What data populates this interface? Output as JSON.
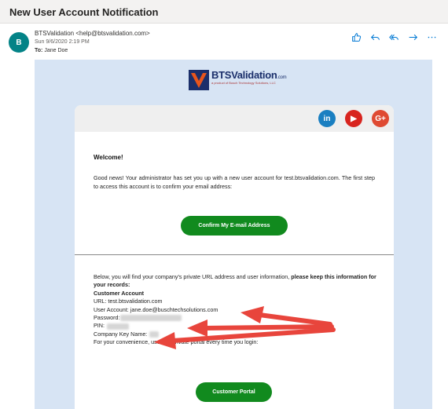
{
  "window": {
    "subject": "New User Account Notification"
  },
  "message": {
    "avatar_initial": "B",
    "sender": "BTSValidation <help@btsvalidation.com>",
    "date": "Sun 9/6/2020 2:19 PM",
    "to_label": "To:",
    "to_value": "Jane Doe"
  },
  "actions": [
    {
      "icon": "like-icon"
    },
    {
      "icon": "reply-icon"
    },
    {
      "icon": "reply-all-icon"
    },
    {
      "icon": "forward-icon"
    },
    {
      "icon": "more-icon"
    }
  ],
  "email": {
    "logo_name": "BTSValidation",
    "logo_suffix": ".com",
    "logo_tagline": "a product of Busch Technology Solutions, LLC",
    "social": [
      {
        "icon": "linkedin-icon",
        "label": "in"
      },
      {
        "icon": "youtube-icon",
        "label": "▶"
      },
      {
        "icon": "google-plus-icon",
        "label": "G+"
      }
    ],
    "welcome": "Welcome!",
    "intro": "Good news! Your administrator has set you up with a new user account for test.btsvalidation.com. The first step to access this account is to confirm your email address:",
    "confirm_button": "Confirm My E-mail Address",
    "info_intro": "Below, you will find your company's private URL address and user information,",
    "info_intro_bold": "please keep this information for your records:",
    "account_heading": "Customer Account",
    "url_line": "URL: test.btsvalidation.com",
    "user_account_line": "User Account: jane.doe@buschtechsolutions.com",
    "password_label": "Password:",
    "pin_label": "PIN:",
    "company_key_label": "Company Key Name:",
    "portal_note": "For your convenience, use this private portal every time you login:",
    "portal_button": "Customer Portal"
  },
  "colors": {
    "accent_green": "#118a1e",
    "body_background": "#d7e4f4",
    "annotation_arrow": "#e8453c",
    "avatar": "#038387"
  }
}
